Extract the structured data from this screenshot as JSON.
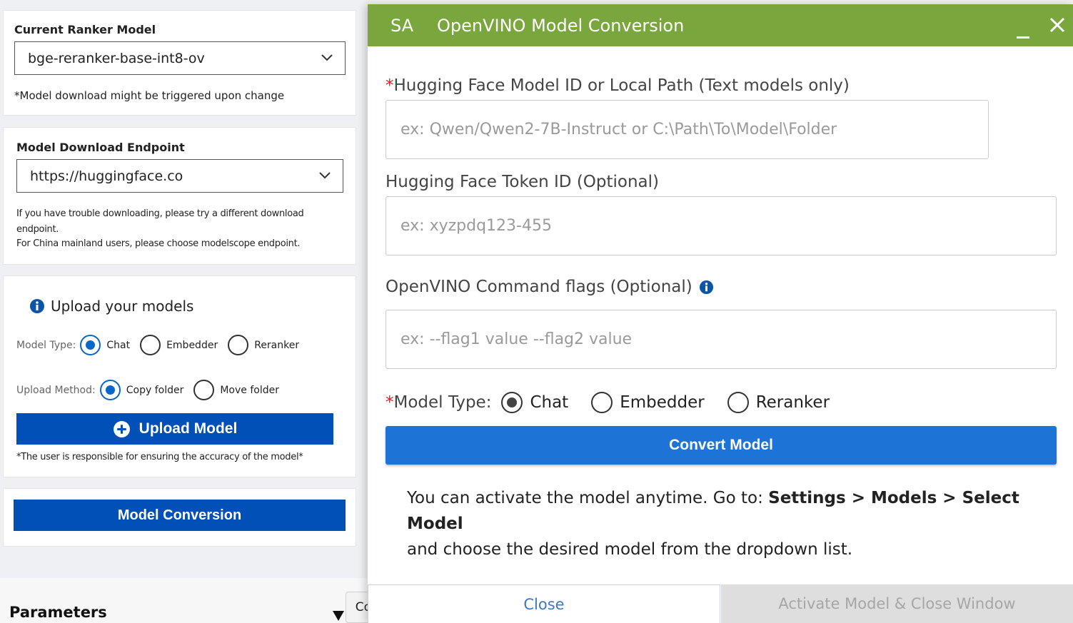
{
  "left": {
    "ranker": {
      "title": "Current Ranker Model",
      "value": "bge-reranker-base-int8-ov",
      "note": "*Model download might be triggered upon change"
    },
    "endpoint": {
      "title": "Model Download Endpoint",
      "value": "https://huggingface.co",
      "note1": "If you have trouble downloading, please try a different download endpoint.",
      "note2": "For China mainland users, please choose modelscope endpoint."
    },
    "upload": {
      "heading": "Upload your models",
      "model_type_label": "Model Type:",
      "model_types": [
        "Chat",
        "Embedder",
        "Reranker"
      ],
      "selected_model_type": "Chat",
      "method_label": "Upload Method:",
      "methods": [
        "Copy folder",
        "Move folder"
      ],
      "selected_method": "Copy folder",
      "button": "Upload Model",
      "disclaimer": "*The user is responsible for ensuring the accuracy of the model*"
    },
    "conversion_button": "Model Conversion",
    "parameters_heading": "Parameters"
  },
  "tooltip": "Copilot",
  "dialog": {
    "badge": "SA",
    "title": "OpenVINO Model Conversion",
    "hf_label_req": "*",
    "hf_label": "Hugging Face Model ID or Local Path (Text models only)",
    "hf_placeholder": "ex: Qwen/Qwen2-7B-Instruct or C:\\Path\\To\\Model\\Folder",
    "token_label": "Hugging Face Token ID (Optional)",
    "token_placeholder": "ex: xyzpdq123-455",
    "flags_label": "OpenVINO Command flags (Optional)",
    "flags_placeholder": "ex: --flag1 value --flag2 value",
    "model_type_req": "*",
    "model_type_label": "Model Type:",
    "model_types": [
      "Chat",
      "Embedder",
      "Reranker"
    ],
    "selected_model_type": "Chat",
    "convert_button": "Convert Model",
    "info_line1_prefix": "You can activate the model anytime. Go to: ",
    "info_path": "Settings > Models > Select Model",
    "info_line2": "and choose the desired model from the dropdown list.",
    "close_button": "Close",
    "activate_button": "Activate Model & Close Window"
  },
  "colors": {
    "titlebar": "#7aa63e",
    "primary_button": "#0050b8",
    "convert_button": "#1e74d6",
    "radio_selected": "#0a66c8"
  }
}
